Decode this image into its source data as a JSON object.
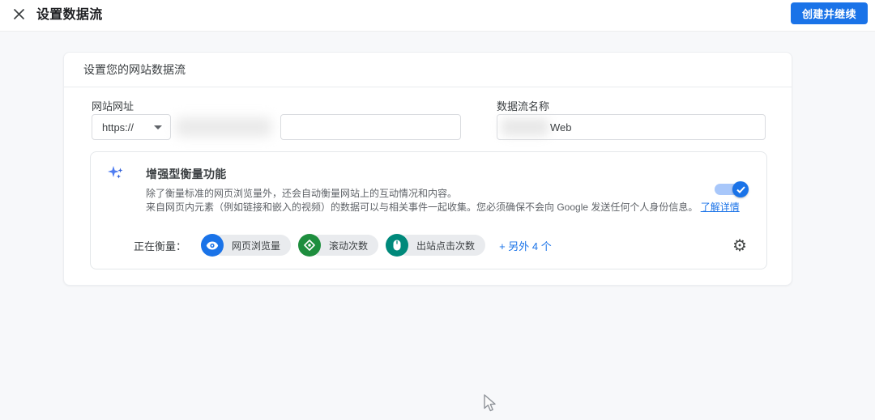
{
  "header": {
    "title": "设置数据流",
    "create_button": "创建并继续"
  },
  "card": {
    "title": "设置您的网站数据流",
    "website_url": {
      "label": "网站网址",
      "protocol": "https://"
    },
    "stream_name": {
      "label": "数据流名称",
      "value_suffix": "Web"
    },
    "enhanced": {
      "title": "增强型衡量功能",
      "desc_line1": "除了衡量标准的网页浏览量外，还会自动衡量网站上的互动情况和内容。",
      "desc_line2": "来自网页内元素（例如链接和嵌入的视频）的数据可以与相关事件一起收集。您必须确保不会向 Google 发送任何个人身份信息。",
      "learn_more": "了解详情",
      "toggle_state": "on",
      "measuring_label": "正在衡量：",
      "chips": [
        {
          "label": "网页浏览量",
          "icon": "eye-icon",
          "color": "#1a73e8"
        },
        {
          "label": "滚动次数",
          "icon": "scroll-icon",
          "color": "#1e8e3e"
        },
        {
          "label": "出站点击次数",
          "icon": "mouse-icon",
          "color": "#00897b"
        }
      ],
      "more_link": "+ 另外 4 个",
      "gear_icon": "⚙"
    }
  },
  "colors": {
    "accent_blue": "#1a73e8",
    "toggle_track": "#a8c7fa",
    "chip_bg": "#e9ebee",
    "chip_green": "#1e8e3e",
    "chip_teal": "#00897b",
    "page_bg": "#f7f8fa",
    "text_primary": "#3c4043",
    "text_secondary": "#5f6368"
  }
}
